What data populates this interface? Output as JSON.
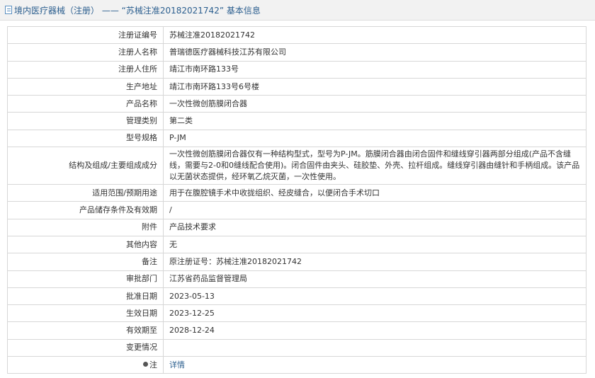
{
  "header": {
    "title": "境内医疗器械（注册） —— “苏械注准20182021742” 基本信息"
  },
  "rows": [
    {
      "label": "注册证编号",
      "value": "苏械注准20182021742"
    },
    {
      "label": "注册人名称",
      "value": "普瑞德医疗器械科技江苏有限公司"
    },
    {
      "label": "注册人住所",
      "value": "靖江市南环路133号"
    },
    {
      "label": "生产地址",
      "value": "靖江市南环路133号6号楼"
    },
    {
      "label": "产品名称",
      "value": "一次性微创筋膜闭合器"
    },
    {
      "label": "管理类别",
      "value": "第二类"
    },
    {
      "label": "型号规格",
      "value": "P-JM"
    },
    {
      "label": "结构及组成/主要组成成分",
      "value": "一次性微创筋膜闭合器仅有一种结构型式，型号为P-JM。筋膜闭合器由闭合固件和缝线穿引器两部分组成(产品不含缝线，需要与2-0和0缝线配合使用)。闭合固件由夹头、硅胶垫、外壳、拉杆组成。缝线穿引器由缝针和手柄组成。该产品以无菌状态提供，经环氧乙烷灭菌，一次性使用。"
    },
    {
      "label": "适用范围/预期用途",
      "value": "用于在腹腔镜手术中收拢组织、经皮缝合，以便闭合手术切口"
    },
    {
      "label": "产品储存条件及有效期",
      "value": "/"
    },
    {
      "label": "附件",
      "value": "产品技术要求"
    },
    {
      "label": "其他内容",
      "value": "无"
    },
    {
      "label": "备注",
      "value": "原注册证号：苏械注准20182021742"
    },
    {
      "label": "审批部门",
      "value": "江苏省药品监督管理局"
    },
    {
      "label": "批准日期",
      "value": "2023-05-13"
    },
    {
      "label": "生效日期",
      "value": "2023-12-25"
    },
    {
      "label": "有效期至",
      "value": "2028-12-24"
    },
    {
      "label": "变更情况",
      "value": ""
    },
    {
      "label": "注",
      "value": "详情"
    }
  ]
}
